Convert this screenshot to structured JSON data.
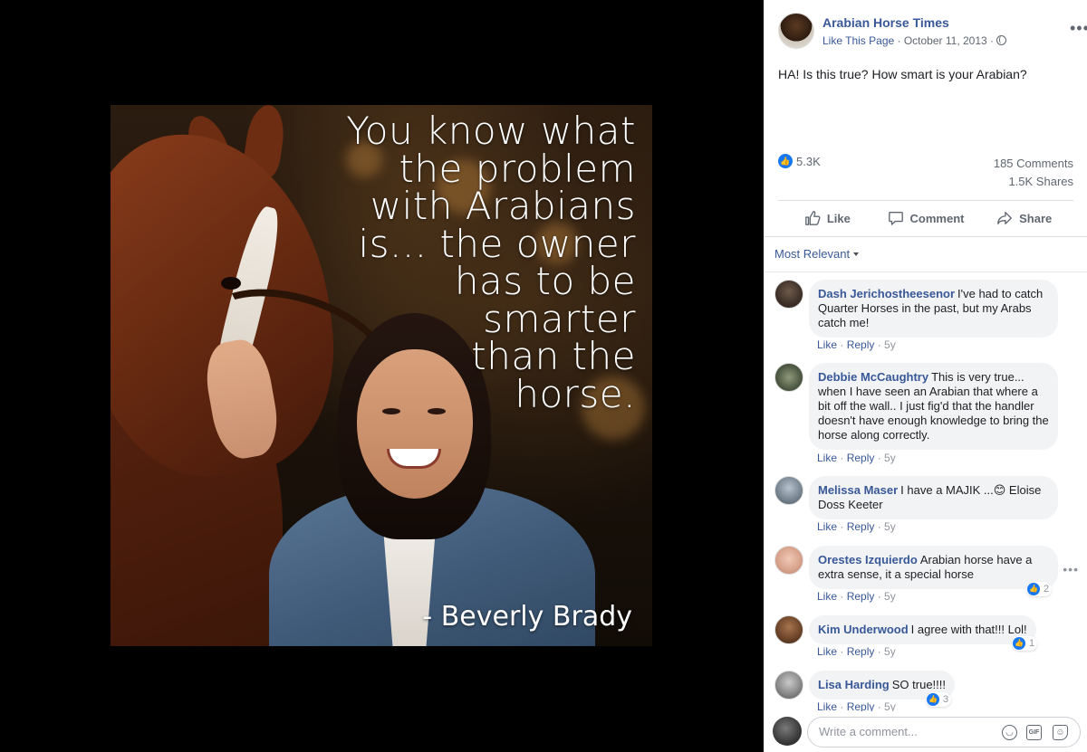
{
  "photo": {
    "quote": "You know what\nthe problem\nwith Arabians\nis... the owner\nhas to be\nsmarter\nthan the\nhorse.",
    "author": "- Beverly Brady"
  },
  "post": {
    "page_name": "Arabian Horse Times",
    "like_page": "Like This Page",
    "date": "October 11, 2013",
    "meta_sep": " · ",
    "text": "HA! Is this true? How smart is your Arabian?",
    "reaction_count": "5.3K",
    "comments_count": "185 Comments",
    "shares_count": "1.5K Shares"
  },
  "actions": {
    "like": "Like",
    "comment": "Comment",
    "share": "Share"
  },
  "sort": {
    "label": "Most Relevant"
  },
  "comments": [
    {
      "author": "Dash Jerichostheesenor",
      "text": "I've had to catch Quarter Horses in the past, but my Arabs catch me!",
      "like": "Like",
      "reply": "Reply",
      "age": "5y"
    },
    {
      "author": "Debbie McCaughtry",
      "text": "This is very true... when I have seen an Arabian that where a bit off the wall.. I just fig'd that the handler doesn't have enough knowledge to bring the horse along correctly.",
      "like": "Like",
      "reply": "Reply",
      "age": "5y"
    },
    {
      "author": "Melissa Maser",
      "text": "I have a MAJIK ...😊 Eloise Doss Keeter",
      "like": "Like",
      "reply": "Reply",
      "age": "5y"
    },
    {
      "author": "Orestes Izquierdo",
      "text": "Arabian horse have a extra sense, it a special horse",
      "like": "Like",
      "reply": "Reply",
      "age": "5y",
      "reactions": "2"
    },
    {
      "author": "Kim Underwood",
      "text": "I agree with that!!! Lol!",
      "like": "Like",
      "reply": "Reply",
      "age": "5y",
      "reactions": "1"
    },
    {
      "author": "Lisa Harding",
      "text": "SO true!!!!",
      "like": "Like",
      "reply": "Reply",
      "age": "5y",
      "reactions": "3"
    }
  ],
  "composer": {
    "placeholder": "Write a comment..."
  },
  "icons": {
    "more": "more-options-icon",
    "globe": "globe-icon",
    "emoji": "emoji-icon",
    "gif": "gif-icon",
    "sticker": "sticker-icon"
  },
  "colors": {
    "link": "#385898",
    "accent": "#1877f2",
    "bubble": "#f2f3f5"
  }
}
